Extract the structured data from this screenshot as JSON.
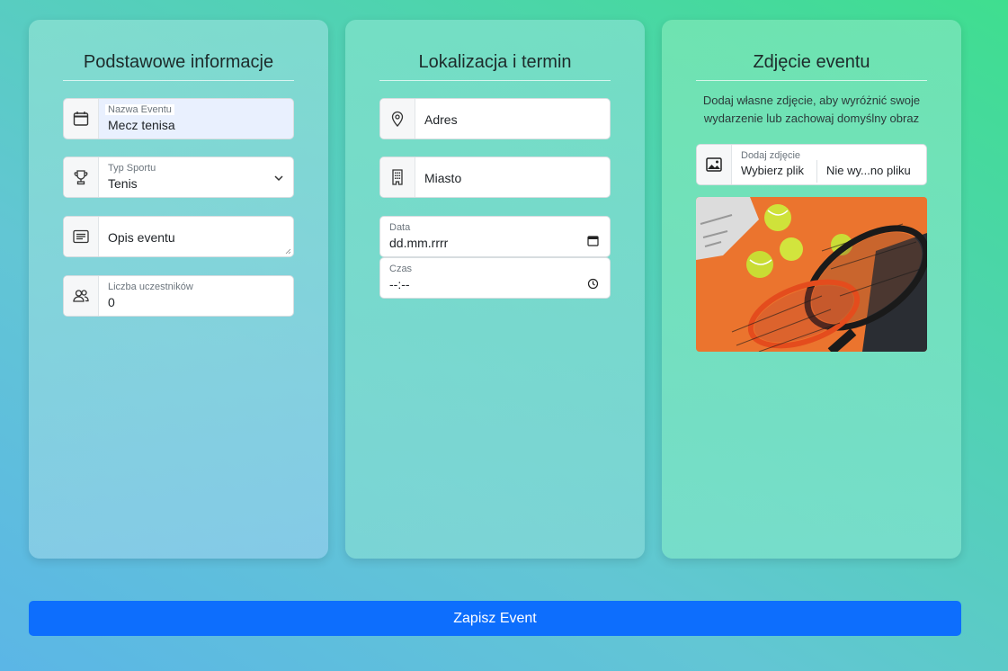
{
  "basic": {
    "title": "Podstawowe informacje",
    "event_name": {
      "label": "Nazwa Eventu",
      "value": "Mecz tenisa"
    },
    "sport_type": {
      "label": "Typ Sportu",
      "value": "Tenis"
    },
    "description": {
      "placeholder": "Opis eventu"
    },
    "participants": {
      "label": "Liczba uczestników",
      "value": "0"
    }
  },
  "location": {
    "title": "Lokalizacja i termin",
    "address": {
      "placeholder": "Adres"
    },
    "city": {
      "placeholder": "Miasto"
    },
    "date": {
      "label": "Data",
      "value": "dd.mm.rrrr"
    },
    "time": {
      "label": "Czas",
      "value": "--:--"
    }
  },
  "photo": {
    "title": "Zdjęcie eventu",
    "description": "Dodaj własne zdjęcie, aby wyróżnić swoje wydarzenie lub zachowaj domyślny obraz",
    "file_label": "Dodaj zdjęcie",
    "choose_button": "Wybierz plik",
    "no_file": "Nie wy...no pliku"
  },
  "actions": {
    "save": "Zapisz Event"
  },
  "colors": {
    "accent": "#0d6efd"
  }
}
